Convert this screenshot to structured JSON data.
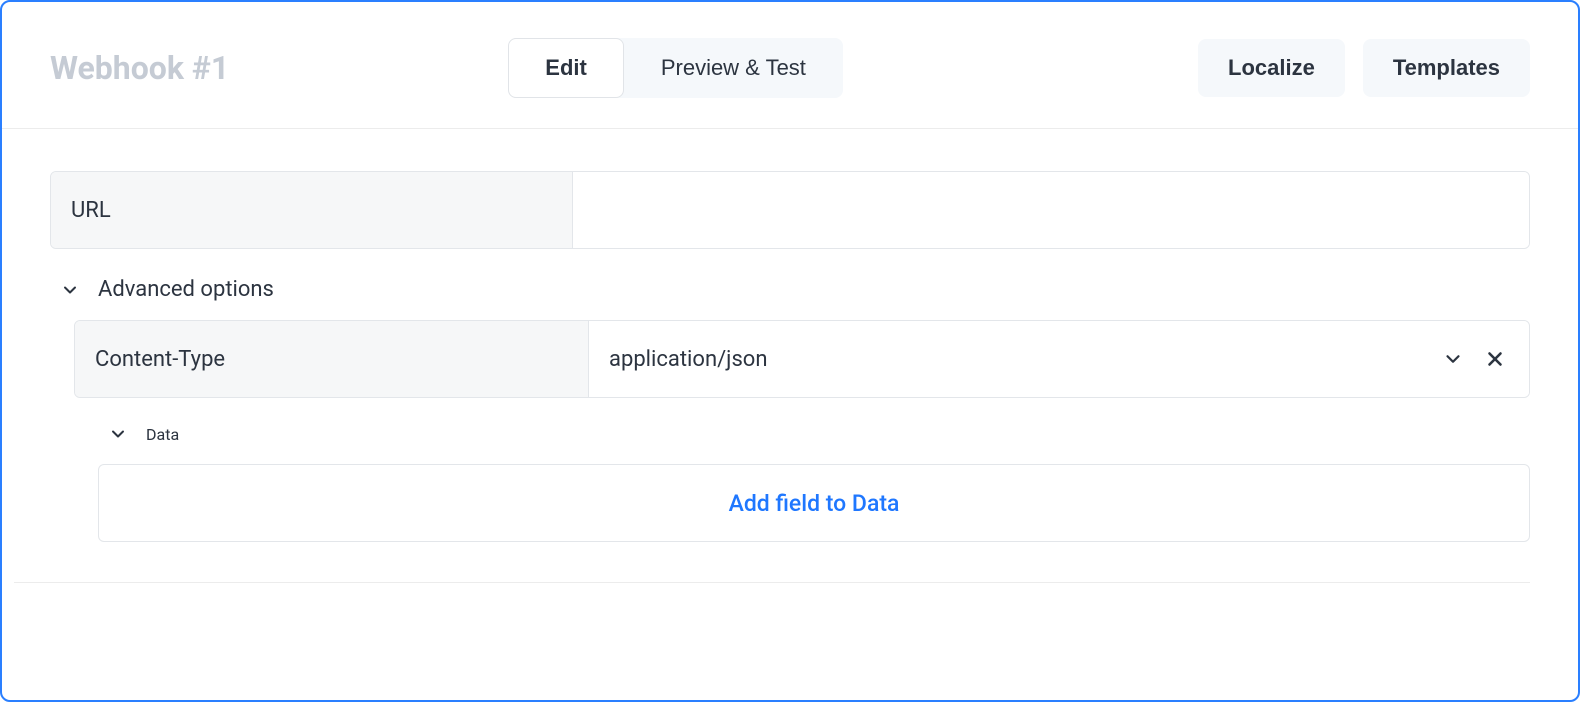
{
  "header": {
    "title": "Webhook #1",
    "tabs": {
      "edit": "Edit",
      "preview": "Preview & Test"
    },
    "actions": {
      "localize": "Localize",
      "templates": "Templates"
    }
  },
  "fields": {
    "url": {
      "label": "URL",
      "value": ""
    }
  },
  "advanced": {
    "label": "Advanced options",
    "contentType": {
      "label": "Content-Type",
      "value": "application/json"
    },
    "data": {
      "label": "Data",
      "addField": "Add field to Data"
    }
  }
}
